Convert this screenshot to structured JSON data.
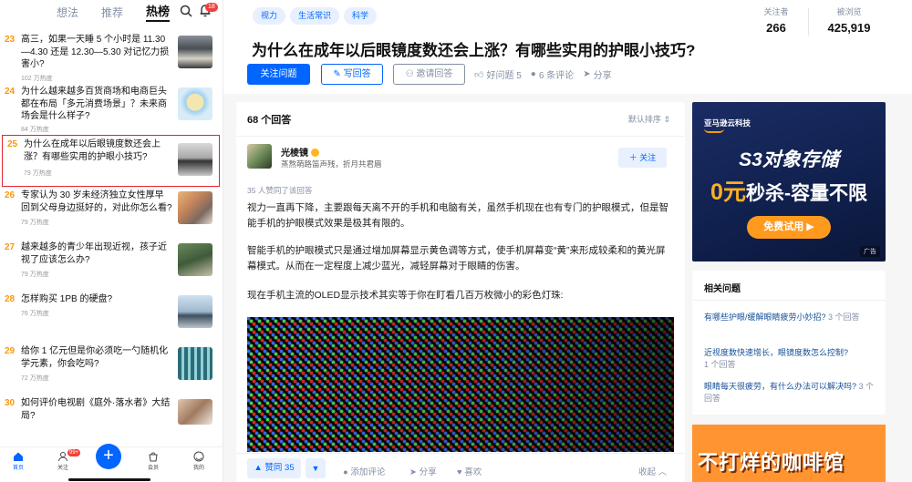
{
  "sidebar": {
    "tabs": [
      "想法",
      "推荐",
      "热榜"
    ],
    "active_tab": "热榜",
    "notif_count": "18",
    "items": [
      {
        "rank": "23",
        "title": "高三，如果一天睡 5 个小时是 11.30—4.30 还是 12.30—5.30 对记忆力损害小?",
        "heat": "102 万热度"
      },
      {
        "rank": "24",
        "title": "为什么越来越多百货商场和电商巨头都在布局「多元消费场景」？未来商场会是什么样子?",
        "heat": "84 万热度"
      },
      {
        "rank": "25",
        "title": "为什么在成年以后眼镜度数还会上涨？有哪些实用的护眼小技巧?",
        "heat": "79 万热度"
      },
      {
        "rank": "26",
        "title": "专家认为 30 岁未经济独立女性厚早回到父母身边挺好的，对此你怎么看?",
        "heat": "79 万热度"
      },
      {
        "rank": "27",
        "title": "越来越多的青少年出现近视，孩子近视了应该怎么办?",
        "heat": "79 万热度"
      },
      {
        "rank": "28",
        "title": "怎样购买 1PB 的硬盘?",
        "heat": "76 万热度"
      },
      {
        "rank": "29",
        "title": "给你 1 亿元但是你必须吃一勺随机化学元素，你会吃吗?",
        "heat": "72 万热度"
      },
      {
        "rank": "30",
        "title": "如何评价电视剧《庭外·落水者》大结局?",
        "heat": ""
      }
    ]
  },
  "bottom_nav": {
    "home": "首页",
    "follow": "关注",
    "follow_badge": "99+",
    "plus": "+",
    "vip": "会员",
    "me": "我的"
  },
  "question": {
    "topics": [
      "视力",
      "生活常识",
      "科学"
    ],
    "title": "为什么在成年以后眼镜度数还会上涨？有哪些实用的护眼小技巧?",
    "followers_label": "关注者",
    "followers": "266",
    "views_label": "被浏览",
    "views": "425,919",
    "follow_btn": "关注问题",
    "answer_btn": "写回答",
    "invite_btn": "邀请回答",
    "good_q": "好问题 5",
    "comments": "6 条评论",
    "share": "分享"
  },
  "answers": {
    "count": "68 个回答",
    "sort": "默认排序",
    "author_name": "光棱镜",
    "author_bio": "蒸熬萌路笛声残，折月共君眉",
    "follow": "关注",
    "agree_count": "35 人赞同了该回答",
    "p1": "视力一直再下降，主要跟每天离不开的手机和电脑有关，虽然手机现在也有专门的护眼模式，但是智能手机的护眼模式效果是极其有限的。",
    "p2": "智能手机的护眼模式只是通过增加屏幕显示黄色调等方式，使手机屏幕变“黄”来形成较柔和的黄光屏幕模式。从而在一定程度上减少蓝光，减轻屏幕对于眼睛的伤害。",
    "p3": "现在手机主流的OLED显示技术其实等于你在盯看几百万枚微小的彩色灯珠:",
    "vote": "赞同 35",
    "add_comment": "添加评论",
    "share": "分享",
    "like": "喜欢",
    "collapse": "收起"
  },
  "ad1": {
    "brand": "亚马逊云科技",
    "headline": "S3对象存储",
    "line2_hl": "0元",
    "line2_rest": "秒杀-容量不限",
    "cta": "免费试用",
    "tag": "广告"
  },
  "related": {
    "title": "相关问题",
    "items": [
      {
        "q": "有哪些护眼/缓解眼睛疲劳小妙招?",
        "c": "3 个回答"
      },
      {
        "q": "近视度数快速增长，眼镜度数怎么控制?",
        "c": "1 个回答"
      },
      {
        "q": "眼睛每天很疲劳，有什么办法可以解决吗?",
        "c": "3 个回答"
      }
    ]
  },
  "ad2": {
    "text": "不打烊的咖啡馆"
  },
  "colors": {
    "accent": "#0066ff",
    "rank": "#ff9607",
    "selected_border": "#e3262c"
  }
}
